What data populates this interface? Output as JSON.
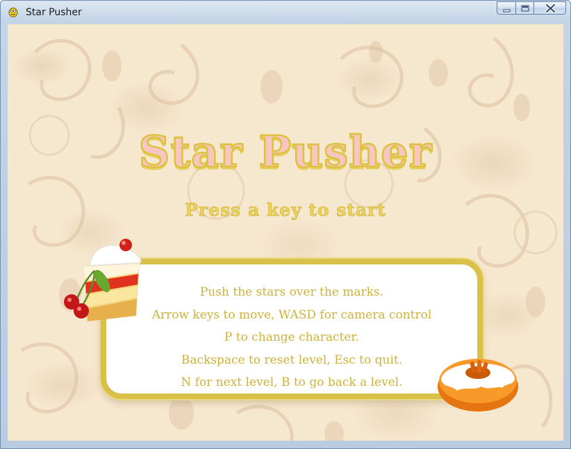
{
  "window": {
    "title": "Star Pusher",
    "icon": "pygame-snake-icon",
    "controls": [
      "minimize-icon",
      "maximize-icon",
      "close-icon"
    ]
  },
  "game": {
    "title": "Star Pusher",
    "prompt": "Press a key to start",
    "instructions": [
      "Push the stars over the marks.",
      "Arrow keys to move, WASD for camera control",
      "P to change character.",
      "Backspace to reset level, Esc to quit.",
      "N for next level, B to go back a level."
    ]
  },
  "colors": {
    "title_fill": "#f8c6c0",
    "title_outline": "#dcc23c",
    "text_gold": "#cfb13a",
    "background": "#f6e7cf",
    "panel_border": "#d9c04b"
  }
}
